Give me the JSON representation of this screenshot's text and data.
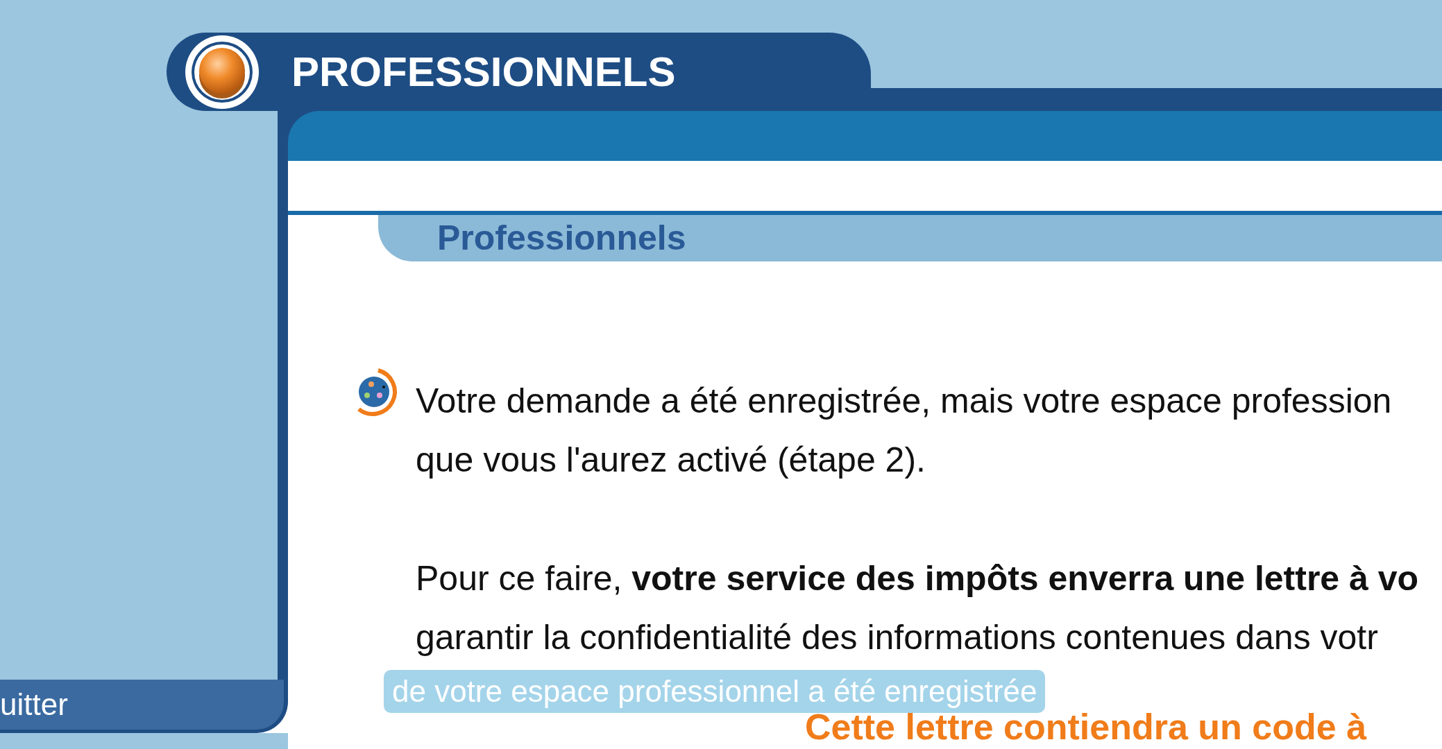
{
  "header": {
    "title": "PROFESSIONNELS"
  },
  "section": {
    "heading": "Professionnels"
  },
  "paragraphs": [
    {
      "lines": [
        "Votre demande a été enregistrée, mais votre espace profession",
        "que vous l'aurez activé (étape 2)."
      ]
    },
    {
      "lines": [
        "Pour ce faire, **votre service des impôts enverra une lettre à vo**",
        "garantir la confidentialité des informations contenues dans votr"
      ]
    }
  ],
  "notice": "Cette lettre contiendra un code à",
  "sidebar": {
    "link": "uitter"
  },
  "caption": "de votre espace professionnel a été enregistrée"
}
